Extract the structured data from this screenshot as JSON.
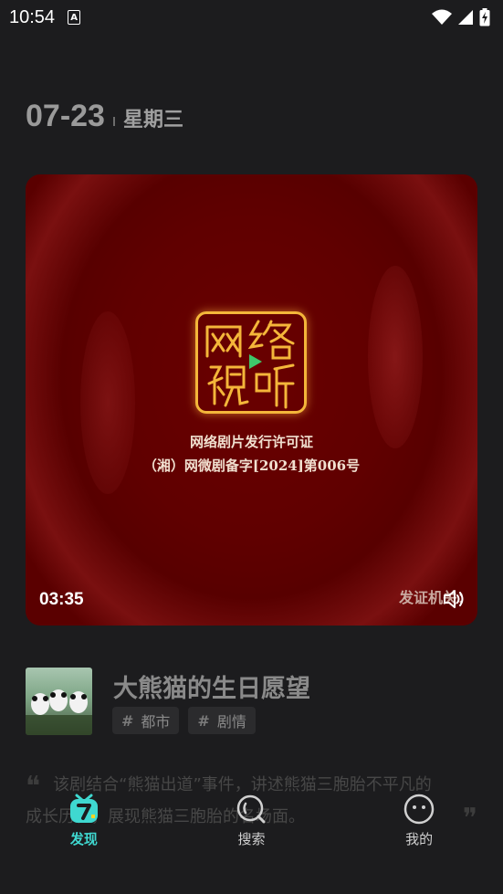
{
  "status_bar": {
    "time": "10:54",
    "notification_icon": "A",
    "icons": [
      "wifi-icon",
      "signal-icon",
      "battery-charging-icon"
    ]
  },
  "header": {
    "date": "07-23",
    "weekday": "星期三"
  },
  "video": {
    "seal_icon": "network-audiovisual-seal",
    "license_title": "网络剧片发行许可证",
    "license_number": "（湘）网微剧备字[2024]第006号",
    "duration": "03:35",
    "caption": "发证机关：",
    "volume_icon": "volume-icon"
  },
  "drama": {
    "title": "大熊猫的生日愿望",
    "tags": [
      "都市",
      "剧情"
    ],
    "synopsis_line1": "该剧结合“熊猫出道”事件，讲述熊猫三胞胎不平凡的",
    "synopsis_line2": "成长历程，展现熊猫三胞胎的名场面。"
  },
  "bottom_nav": {
    "items": [
      {
        "label": "发现",
        "icon": "discover-icon",
        "active": true
      },
      {
        "label": "搜索",
        "icon": "search-icon",
        "active": false
      },
      {
        "label": "我的",
        "icon": "profile-face-icon",
        "active": false
      }
    ]
  },
  "colors": {
    "background": "#1c1c1e",
    "accent": "#3fd8d0",
    "accent_yellow": "#f5d423",
    "video_bg": "#600000"
  }
}
